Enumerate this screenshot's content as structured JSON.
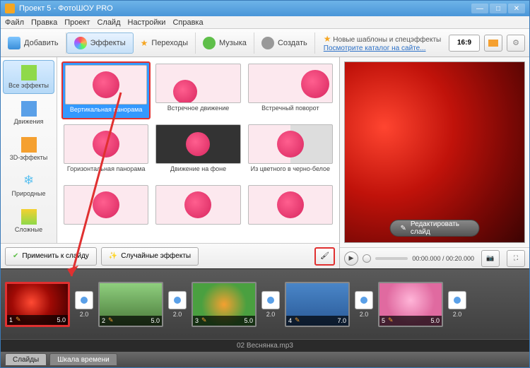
{
  "window": {
    "title": "Проект 5 - ФотоШОУ PRO"
  },
  "menu": [
    "Файл",
    "Правка",
    "Проект",
    "Слайд",
    "Настройки",
    "Справка"
  ],
  "toolbar": {
    "add": "Добавить",
    "effects": "Эффекты",
    "transitions": "Переходы",
    "music": "Музыка",
    "create": "Создать"
  },
  "promo": {
    "line1": "Новые шаблоны и спецэффекты",
    "line2": "Посмотрите каталог на сайте..."
  },
  "aspect": "16:9",
  "categories": [
    {
      "label": "Все эффекты",
      "sel": true
    },
    {
      "label": "Движения"
    },
    {
      "label": "3D-эффекты"
    },
    {
      "label": "Природные"
    },
    {
      "label": "Сложные"
    }
  ],
  "effects": [
    {
      "label": "Вертикальная панорама",
      "sel": true
    },
    {
      "label": "Встречное движение"
    },
    {
      "label": "Встречный поворот"
    },
    {
      "label": "Горизонтальная панорама"
    },
    {
      "label": "Движение на фоне"
    },
    {
      "label": "Из цветного в черно-белое"
    },
    {
      "label": ""
    },
    {
      "label": ""
    },
    {
      "label": ""
    }
  ],
  "actions": {
    "apply": "Применить к слайду",
    "random": "Случайные эффекты"
  },
  "preview": {
    "edit": "Редактировать слайд"
  },
  "time": "00:00.000 / 00:20.000",
  "slides": [
    {
      "num": "1",
      "dur": "5.0",
      "trans": "2.0",
      "sel": true,
      "bg": "radial-gradient(circle at 40% 45%,#ff4a33,#a00a05 45%,#400)"
    },
    {
      "num": "2",
      "dur": "5.0",
      "trans": "2.0",
      "bg": "linear-gradient(#8fcf7e,#4a7a3a)"
    },
    {
      "num": "3",
      "dur": "5.0",
      "trans": "2.0",
      "bg": "radial-gradient(circle at 50% 50%,#f5a030,#4aa040 60%)"
    },
    {
      "num": "4",
      "dur": "7.0",
      "trans": "2.0",
      "bg": "linear-gradient(#4a86c8,#2a5a98)"
    },
    {
      "num": "5",
      "dur": "5.0",
      "trans": "2.0",
      "bg": "radial-gradient(circle at 50% 40%,#ffb5d8,#e06aa0 60%)"
    }
  ],
  "audio": "02 Веснянка.mp3",
  "footer": {
    "slides": "Слайды",
    "timeline": "Шкала времени"
  }
}
